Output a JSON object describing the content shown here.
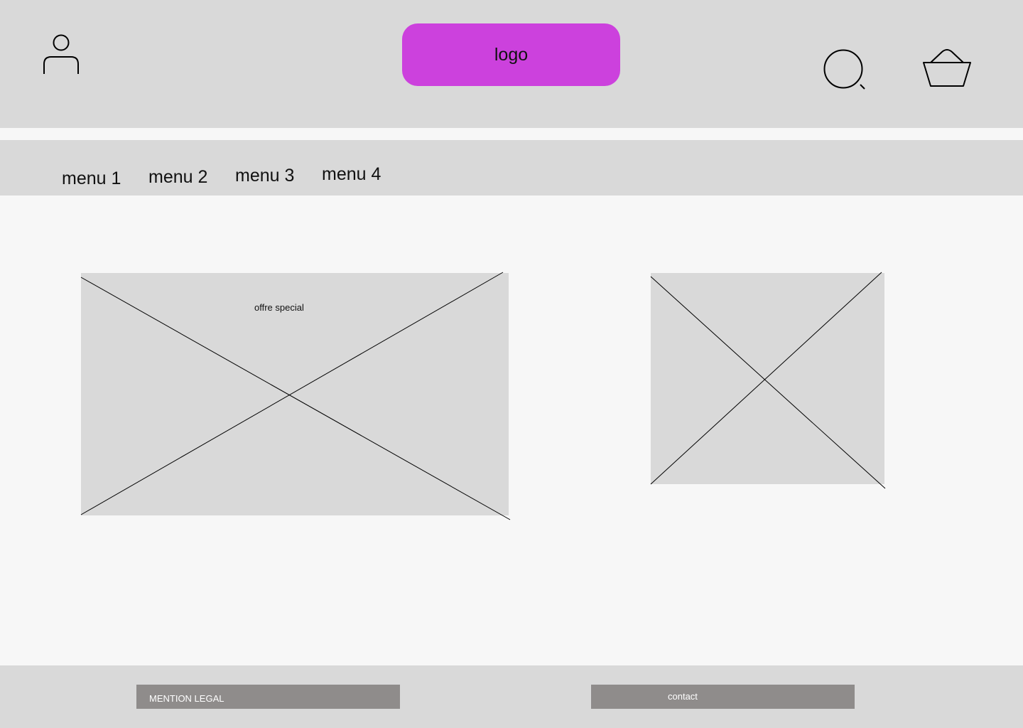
{
  "header": {
    "logo_label": "logo",
    "icons": [
      "user-icon",
      "search-icon",
      "basket-icon"
    ],
    "logo_color": "#cc41dd",
    "background": "#d9d9d9"
  },
  "nav": {
    "items": [
      {
        "label": "menu 1"
      },
      {
        "label": "menu 2"
      },
      {
        "label": "menu 3"
      },
      {
        "label": "menu 4"
      }
    ]
  },
  "main": {
    "offer": {
      "label": "offre special"
    },
    "secondary_image": {
      "label": ""
    }
  },
  "footer": {
    "legal_label": "MENTION LEGAL",
    "contact_label": "contact",
    "button_color": "#8f8c8b"
  }
}
